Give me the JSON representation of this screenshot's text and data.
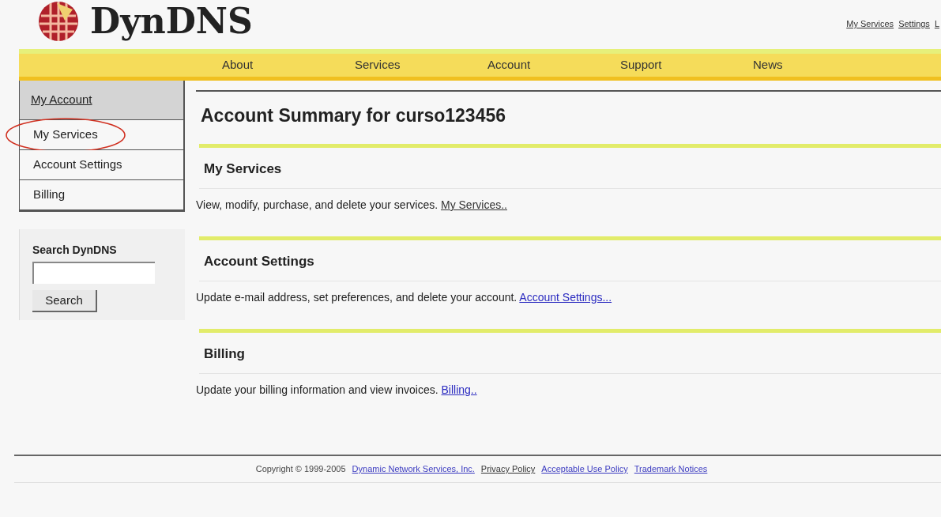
{
  "logo": {
    "text": "DynDNS"
  },
  "top_links": [
    "My Services",
    "Settings",
    "L"
  ],
  "nav": [
    "About",
    "Services",
    "Account",
    "Support",
    "News"
  ],
  "sidebar": {
    "items": [
      {
        "label": "My Account",
        "selected": true,
        "circled": false
      },
      {
        "label": "My Services",
        "selected": false,
        "circled": true
      },
      {
        "label": "Account Settings",
        "selected": false,
        "circled": false
      },
      {
        "label": "Billing",
        "selected": false,
        "circled": false
      }
    ],
    "annotation": {
      "kind": "ellipse",
      "color": "#d03020"
    }
  },
  "search": {
    "title": "Search DynDNS",
    "button": "Search"
  },
  "main": {
    "title": "Account Summary for curso123456",
    "sections": [
      {
        "heading": "My Services",
        "text": "View, modify, purchase, and delete your services.",
        "link": "My Services..",
        "link_visited": true
      },
      {
        "heading": "Account Settings",
        "text": "Update e-mail address, set preferences, and delete your account.",
        "link": "Account Settings...",
        "link_visited": false
      },
      {
        "heading": "Billing",
        "text": "Update your billing information and view invoices.",
        "link": "Billing..",
        "link_visited": false
      }
    ]
  },
  "footer": {
    "copyright": "Copyright © 1999-2005",
    "links": [
      {
        "label": "Dynamic Network Services, Inc.",
        "visited": false
      },
      {
        "label": "Privacy Policy",
        "visited": true
      },
      {
        "label": "Acceptable Use Policy",
        "visited": false
      },
      {
        "label": "Trademark Notices",
        "visited": false
      }
    ]
  }
}
